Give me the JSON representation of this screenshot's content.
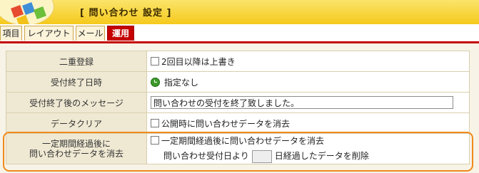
{
  "header": {
    "title": "[ 問い合わせ 設定 ]"
  },
  "tabs": [
    {
      "label": "項目",
      "active": false
    },
    {
      "label": "レイアウト",
      "active": false
    },
    {
      "label": "メール",
      "active": false
    },
    {
      "label": "運用",
      "active": true
    }
  ],
  "rows": {
    "double_registration": {
      "label": "二重登録",
      "checkbox_label": "2回目以降は上書き"
    },
    "end_datetime": {
      "label": "受付終了日時",
      "value": "指定なし"
    },
    "end_message": {
      "label": "受付終了後のメッセージ",
      "value": "問い合わせの受付を終了致しました。"
    },
    "data_clear": {
      "label": "データクリア",
      "checkbox_label": "公開時に問い合わせデータを消去"
    },
    "period_clear": {
      "label_line1": "一定期間経過後に",
      "label_line2": "問い合わせデータを消去",
      "checkbox_label": "一定期間経過後に問い合わせデータを消去",
      "sub_prefix": "問い合わせ受付日より",
      "sub_suffix": "日経過したデータを削除"
    }
  },
  "icons": {
    "clock": "clock-icon",
    "logo": "logo-icon"
  },
  "colors": {
    "accent_red": "#c40000",
    "header_yellow": "#f5c91c",
    "highlight_orange": "#f08a1c"
  }
}
